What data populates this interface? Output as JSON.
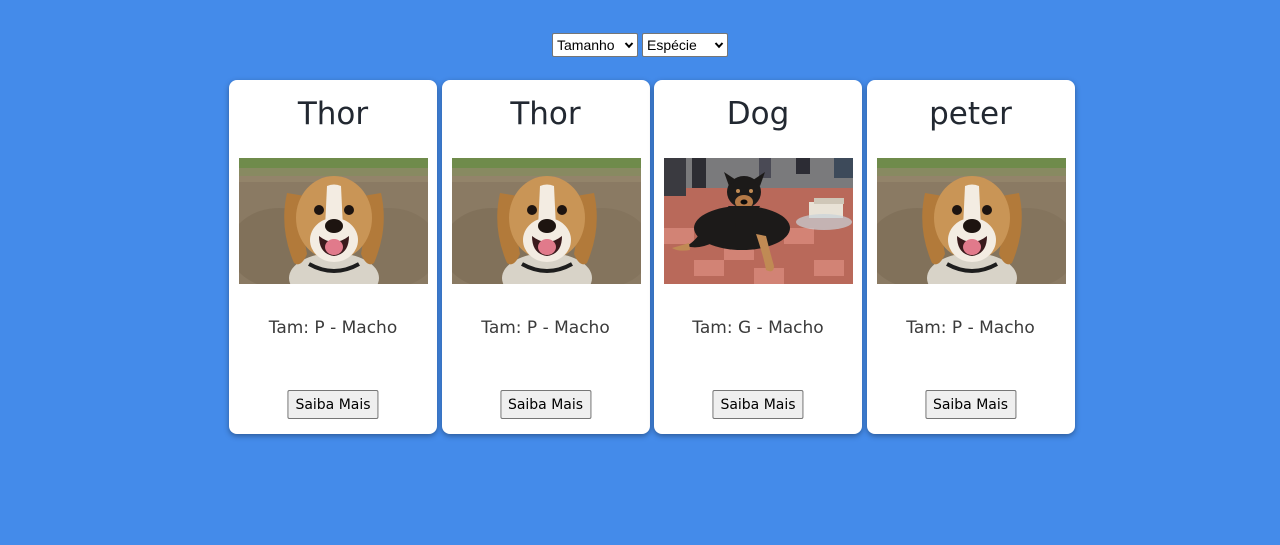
{
  "filters": {
    "size_select": {
      "selected": "Tamanho"
    },
    "species_select": {
      "selected": "Espécie"
    }
  },
  "cards": [
    {
      "name": "Thor",
      "info": "Tam: P - Macho",
      "button": "Saiba Mais",
      "photo": "beagle-photo"
    },
    {
      "name": "Thor",
      "info": "Tam: P - Macho",
      "button": "Saiba Mais",
      "photo": "beagle-photo"
    },
    {
      "name": "Dog",
      "info": "Tam: G - Macho",
      "button": "Saiba Mais",
      "photo": "street-dog-photo"
    },
    {
      "name": "peter",
      "info": "Tam: P - Macho",
      "button": "Saiba Mais",
      "photo": "beagle-photo"
    }
  ],
  "colors": {
    "background": "#448bea",
    "card": "#ffffff",
    "title_text": "#222831"
  }
}
